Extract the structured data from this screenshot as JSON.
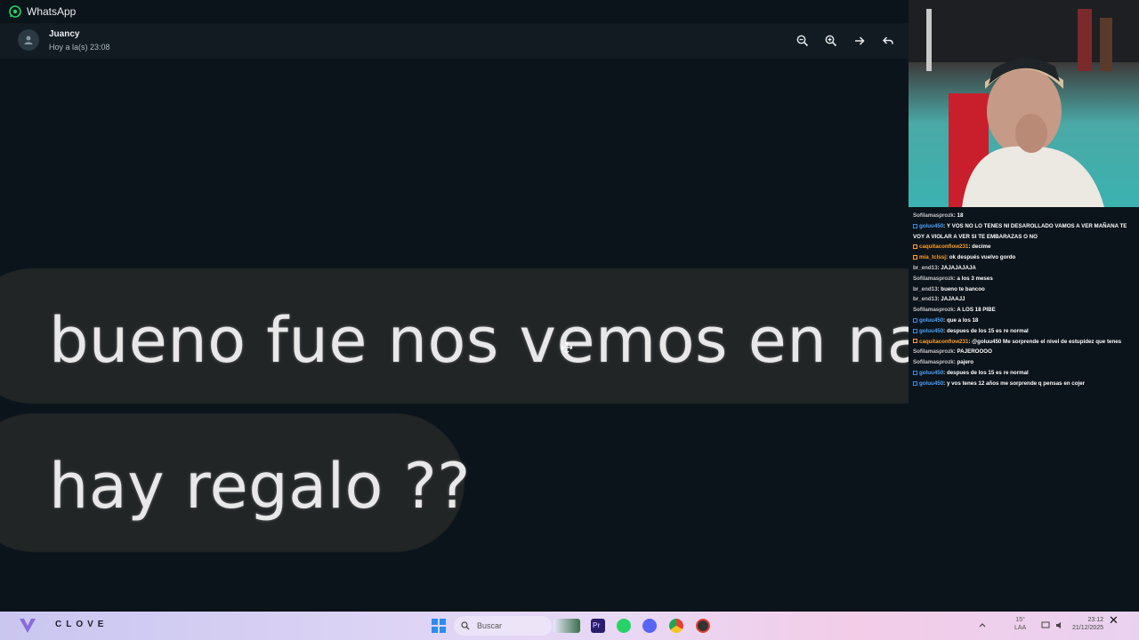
{
  "app": {
    "title": "WhatsApp"
  },
  "header": {
    "sender": "Juancy",
    "timestamp": "Hoy a la(s) 23:08",
    "actions": [
      "zoom-out-icon",
      "zoom-in-icon",
      "forward-icon",
      "reply-icon"
    ]
  },
  "media": {
    "messages": [
      {
        "text": "bueno fue nos vemos en navid"
      },
      {
        "text": "hay regalo ??"
      }
    ]
  },
  "chat": {
    "lines": [
      {
        "user": "Sofilamasprozk",
        "text": ": 18",
        "badge": "none"
      },
      {
        "user": "goluu450",
        "text": ": Y VOS NO LO TENES NI DESAROLLADO VAMOS A VER MAÑANA TE VOY A VIOLAR A VER SI TE EMBARAZAS O NO",
        "badge": "blue"
      },
      {
        "user": "caquitaconflow231",
        "text": ": decime",
        "badge": "orange"
      },
      {
        "user": "mia_tclssj",
        "text": ": ok después vuelvo gordo",
        "badge": "orange"
      },
      {
        "user": "br_end13",
        "text": ": JAJAJAJAJA",
        "badge": "none"
      },
      {
        "user": "Sofilamasprozk",
        "text": ": a los 3 meses",
        "badge": "none"
      },
      {
        "user": "br_end13",
        "text": ": bueno te bancoo",
        "badge": "none"
      },
      {
        "user": "br_end13",
        "text": ": JAJAAJJ",
        "badge": "none"
      },
      {
        "user": "Sofilamasprozk",
        "text": ": A LOS 18 PIBE",
        "badge": "none"
      },
      {
        "user": "goluu450",
        "text": ": que a los 18",
        "badge": "blue"
      },
      {
        "user": "goluu450",
        "text": ": despues de los 15 es re normal",
        "badge": "blue"
      },
      {
        "user": "caquitaconflow231",
        "text": ": @goluu450 Me sorprende el nivel de estupidez que tenes",
        "badge": "orange"
      },
      {
        "user": "Sofilamasprozk",
        "text": ": PAJEROOOO",
        "badge": "none"
      },
      {
        "user": "Sofilamasprozk",
        "text": ": pajero",
        "badge": "none"
      },
      {
        "user": "goluu450",
        "text": ": despues de los 15 es re normal",
        "badge": "blue"
      },
      {
        "user": "goluu450",
        "text": ": y vos tenes 12 años me sorprende q pensas en cojer",
        "badge": "blue"
      }
    ]
  },
  "taskbar": {
    "brand": "CLOVE",
    "search_placeholder": "Buscar",
    "tray_top": "15°",
    "tray_bottom": "LAA",
    "clock_time": "23:12",
    "clock_date": "21/12/2025",
    "close_label": "✕",
    "colors": {
      "premiere": "#2a1d6b",
      "whatsapp": "#25d366",
      "discord": "#5865f2",
      "chrome": "#e34133"
    }
  }
}
